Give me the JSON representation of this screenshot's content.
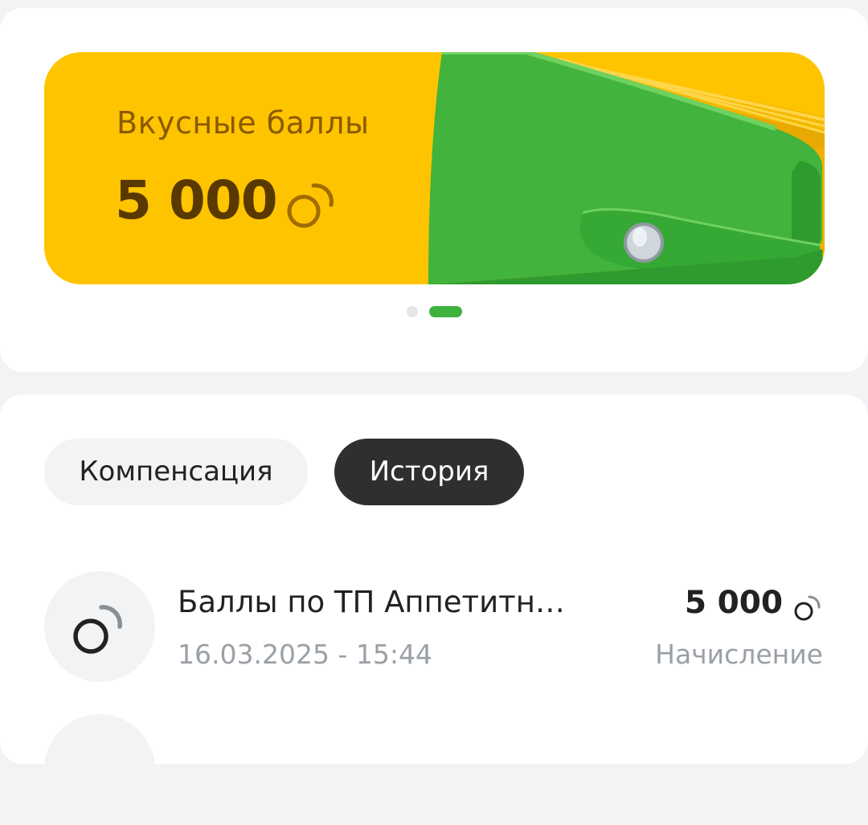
{
  "banner": {
    "title": "Вкусные баллы",
    "amount": "5 000",
    "bg_color": "#ffc400",
    "illustration": "green-wallet-illustration",
    "coin_icon": "coin-icon"
  },
  "carousel": {
    "pages": 2,
    "active_page": 2,
    "active_color": "#3fb13f"
  },
  "tabs": [
    {
      "label": "Компенсация",
      "active": false
    },
    {
      "label": "История",
      "active": true
    }
  ],
  "history": [
    {
      "title": "Баллы по ТП Аппетитн…",
      "date": "16.03.2025 - 15:44",
      "amount": "5 000",
      "type": "Начисление",
      "icon": "coin-icon"
    }
  ]
}
